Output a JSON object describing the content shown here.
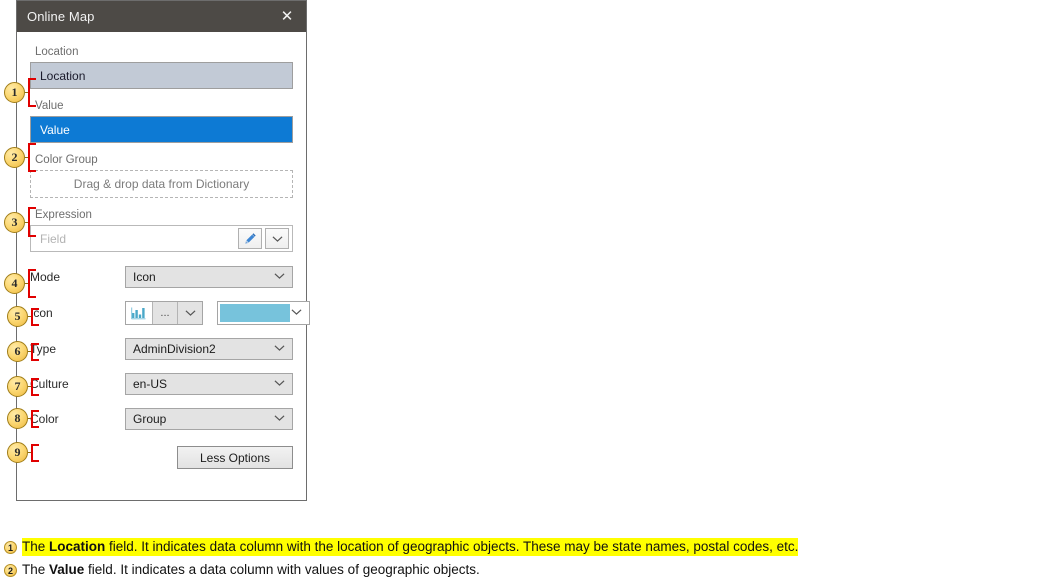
{
  "window": {
    "title": "Online Map",
    "close_label": "✕"
  },
  "panel": {
    "location": {
      "label": "Location",
      "value": "Location"
    },
    "value": {
      "label": "Value",
      "value": "Value"
    },
    "color_group": {
      "label": "Color Group",
      "placeholder": "Drag & drop data from Dictionary"
    },
    "expression": {
      "label": "Expression",
      "placeholder": "Field",
      "value": ""
    },
    "mode": {
      "label": "Mode",
      "value": "Icon"
    },
    "icon": {
      "label": "Icon",
      "dots_label": "...",
      "swatch_color": "#77c3dc"
    },
    "type": {
      "label": "Type",
      "value": "AdminDivision2"
    },
    "culture": {
      "label": "Culture",
      "value": "en-US"
    },
    "color": {
      "label": "Color",
      "value": "Group"
    },
    "less_options_label": "Less Options"
  },
  "callouts": [
    {
      "n": "1"
    },
    {
      "n": "2"
    },
    {
      "n": "3"
    },
    {
      "n": "4"
    },
    {
      "n": "5"
    },
    {
      "n": "6"
    },
    {
      "n": "7"
    },
    {
      "n": "8"
    },
    {
      "n": "9"
    }
  ],
  "captions": [
    {
      "num": "1",
      "pre": "The ",
      "bold": "Location",
      "post": " field. It indicates data column with the location of geographic objects. These may be state names, postal codes, etc.",
      "highlighted": true
    },
    {
      "num": "2",
      "pre": "The ",
      "bold": "Value",
      "post": " field. It indicates a data column with values of geographic objects.",
      "highlighted": false
    }
  ],
  "colors": {
    "titlebar": "#4d4a46",
    "selected_field": "#0d7ad4",
    "location_field": "#c2cad6",
    "accent_badge": "#fcd976",
    "bracket": "#e00000",
    "highlight": "#ffff00"
  }
}
